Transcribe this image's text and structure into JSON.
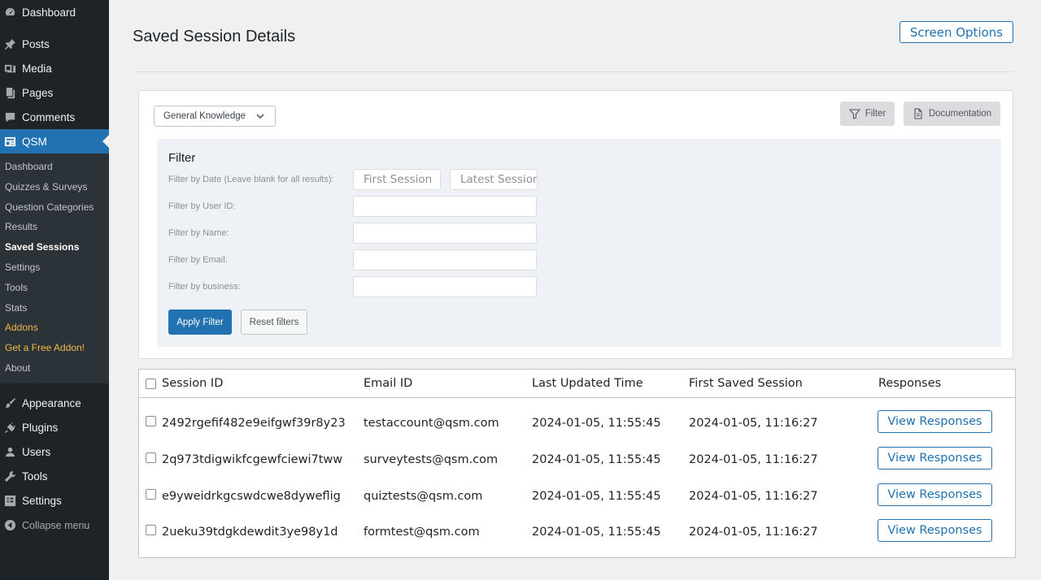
{
  "sidebar": {
    "top_items": [
      {
        "label": "Dashboard",
        "icon": "dashboard-icon"
      },
      {
        "label": "Posts",
        "icon": "pin-icon"
      },
      {
        "label": "Media",
        "icon": "media-icon"
      },
      {
        "label": "Pages",
        "icon": "pages-icon"
      },
      {
        "label": "Comments",
        "icon": "comment-icon"
      },
      {
        "label": "QSM",
        "icon": "qsm-icon"
      }
    ],
    "qsm_submenu": [
      "Dashboard",
      "Quizzes & Surveys",
      "Question Categories",
      "Results",
      "Saved Sessions",
      "Settings",
      "Tools",
      "Stats",
      "Addons",
      "Get a Free Addon!",
      "About"
    ],
    "bottom_items": [
      {
        "label": "Appearance",
        "icon": "brush-icon"
      },
      {
        "label": "Plugins",
        "icon": "plug-icon"
      },
      {
        "label": "Users",
        "icon": "user-icon"
      },
      {
        "label": "Tools",
        "icon": "wrench-icon"
      },
      {
        "label": "Settings",
        "icon": "settings-icon"
      }
    ],
    "collapse_label": "Collapse menu",
    "current_submenu": "Saved Sessions"
  },
  "header": {
    "title": "Saved Session Details",
    "screen_options": "Screen Options"
  },
  "toolbar": {
    "quiz_select": "General Knowledge",
    "filter_button": "Filter",
    "documentation_button": "Documentation"
  },
  "filter": {
    "heading": "Filter",
    "date_label": "Filter by Date (Leave blank for all results):",
    "date_from_placeholder": "First Session",
    "date_to_placeholder": "Latest Session",
    "user_id_label": "Filter by User ID:",
    "name_label": "Filter by Name:",
    "email_label": "Filter by Email:",
    "business_label": "Filter by business:",
    "apply_label": "Apply Filter",
    "reset_label": "Reset filters"
  },
  "table": {
    "columns": [
      "Session ID",
      "Email ID",
      "Last Updated Time",
      "First Saved Session",
      "Responses"
    ],
    "rows": [
      {
        "session_id": "2492rgefif482e9eifgwf39r8y23",
        "email": "testaccount@qsm.com",
        "last_updated": "2024-01-05, 11:55:45",
        "first_saved": "2024-01-05, 11:16:27",
        "action": "View Responses"
      },
      {
        "session_id": "2q973tdigwikfcgewfciewi7tww",
        "email": "surveytests@qsm.com",
        "last_updated": "2024-01-05, 11:55:45",
        "first_saved": "2024-01-05, 11:16:27",
        "action": "View Responses"
      },
      {
        "session_id": "e9yweidrkgcswdcwe8dyweflig",
        "email": "quiztests@qsm.com",
        "last_updated": "2024-01-05, 11:55:45",
        "first_saved": "2024-01-05, 11:16:27",
        "action": "View Responses"
      },
      {
        "session_id": "2ueku39tdgkdewdit3ye98y1d",
        "email": "formtest@qsm.com",
        "last_updated": "2024-01-05, 11:55:45",
        "first_saved": "2024-01-05, 11:16:27",
        "action": "View Responses"
      }
    ]
  },
  "colors": {
    "sidebar_bg": "#1d2327",
    "accent": "#2271b1",
    "page_bg": "#f0f0f1",
    "addon_orange": "#f0b849"
  }
}
